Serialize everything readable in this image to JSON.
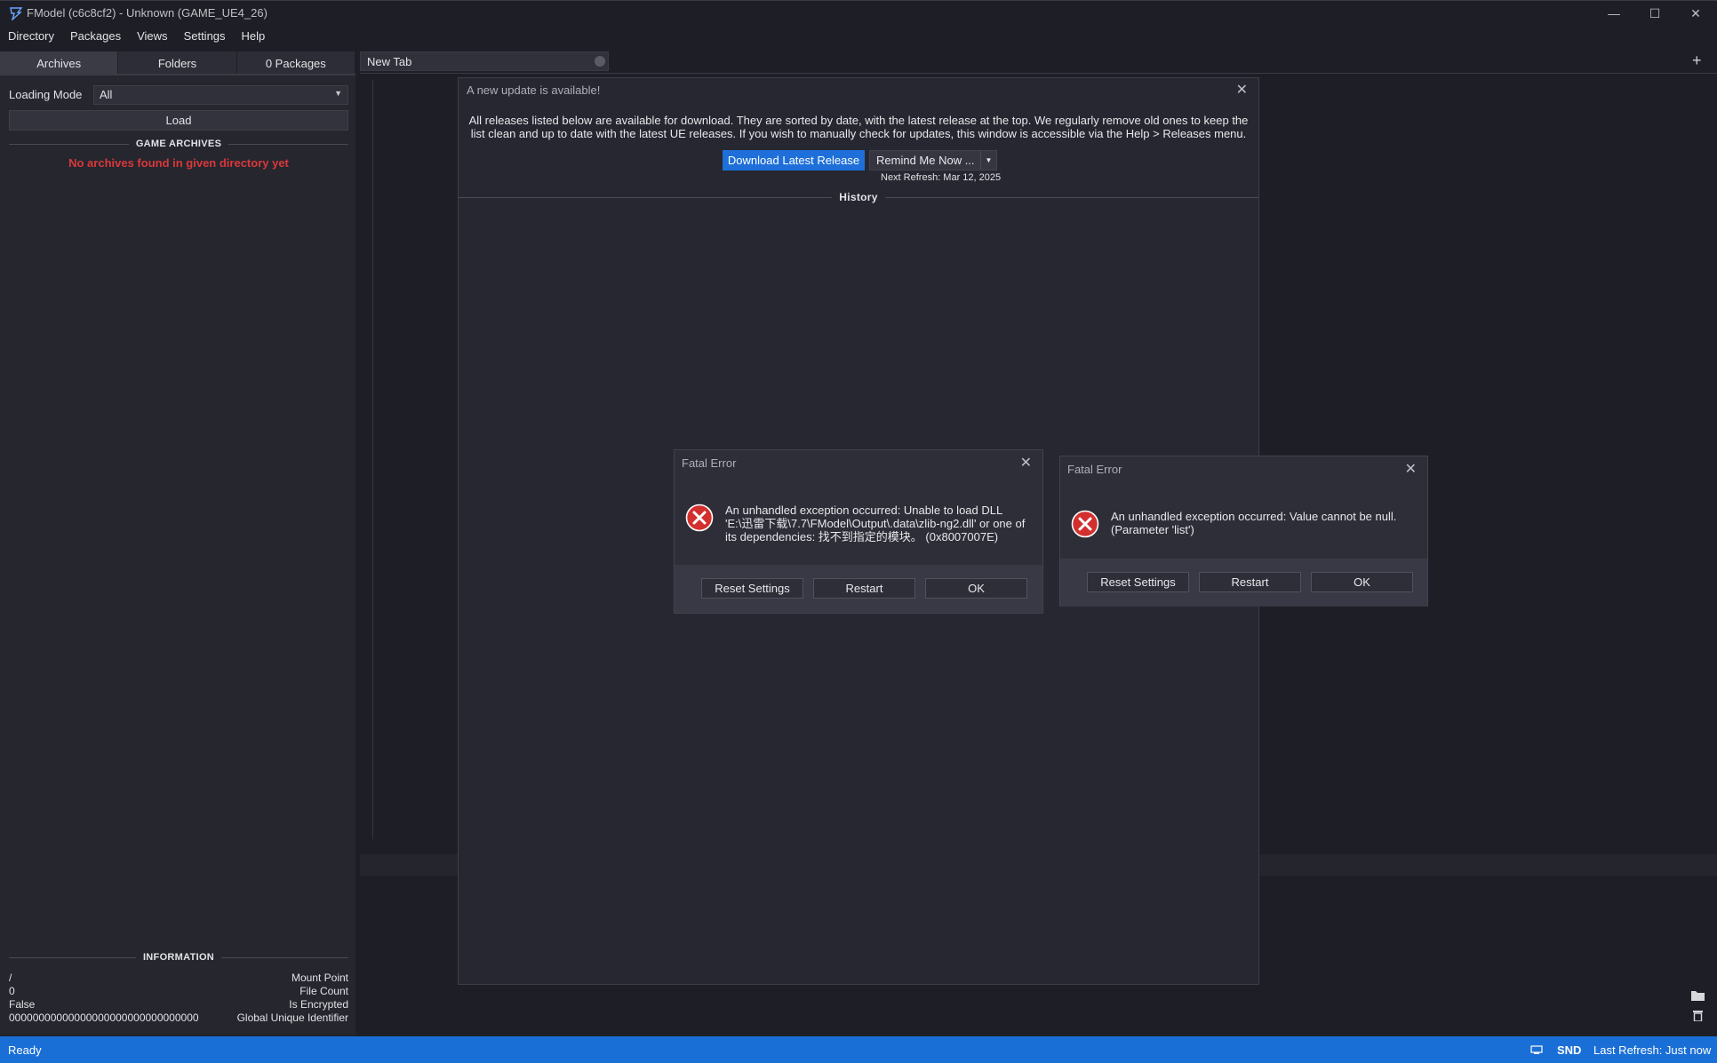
{
  "window": {
    "title": "FModel (c6c8cf2) - Unknown (GAME_UE4_26)",
    "accent_color": "#1a6fd6"
  },
  "menu": [
    "Directory",
    "Packages",
    "Views",
    "Settings",
    "Help"
  ],
  "left_panel": {
    "tabs": [
      "Archives",
      "Folders",
      "0 Packages"
    ],
    "loading_mode_label": "Loading Mode",
    "loading_mode_value": "All",
    "load_label": "Load",
    "game_archives_heading": "GAME ARCHIVES",
    "no_archives_text": "No archives found in given directory yet",
    "information_heading": "INFORMATION",
    "info": [
      {
        "value": "/",
        "key": "Mount Point"
      },
      {
        "value": "0",
        "key": "File Count"
      },
      {
        "value": "False",
        "key": "Is Encrypted"
      },
      {
        "value": "00000000000000000000000000000000",
        "key": "Global Unique Identifier"
      }
    ]
  },
  "editor": {
    "tab_label": "New Tab",
    "add_tab_symbol": "+"
  },
  "update_dialog": {
    "title": "A new update is available!",
    "description": "All releases listed below are available for download. They are sorted by date, with the latest release at the top. We regularly remove old ones to keep the list clean and up to date with the latest UE releases. If you wish to manually check for updates, this window is accessible via the Help > Releases menu.",
    "download_label": "Download Latest Release",
    "remind_label": "Remind Me Now ...",
    "next_refresh": "Next Refresh: Mar 12, 2025",
    "history_heading": "History"
  },
  "errors": [
    {
      "title": "Fatal Error",
      "message": "An unhandled exception occurred: Unable to load DLL 'E:\\迅雷下载\\7.7\\FModel\\Output\\.data\\zlib-ng2.dll' or one of its dependencies: 找不到指定的模块。 (0x8007007E)",
      "buttons": [
        "Reset Settings",
        "Restart",
        "OK"
      ]
    },
    {
      "title": "Fatal Error",
      "message": "An unhandled exception occurred: Value cannot be null. (Parameter 'list')",
      "buttons": [
        "Reset Settings",
        "Restart",
        "OK"
      ]
    }
  ],
  "status_bar": {
    "status": "Ready",
    "snd": "SND",
    "last_refresh": "Last Refresh: Just now"
  }
}
